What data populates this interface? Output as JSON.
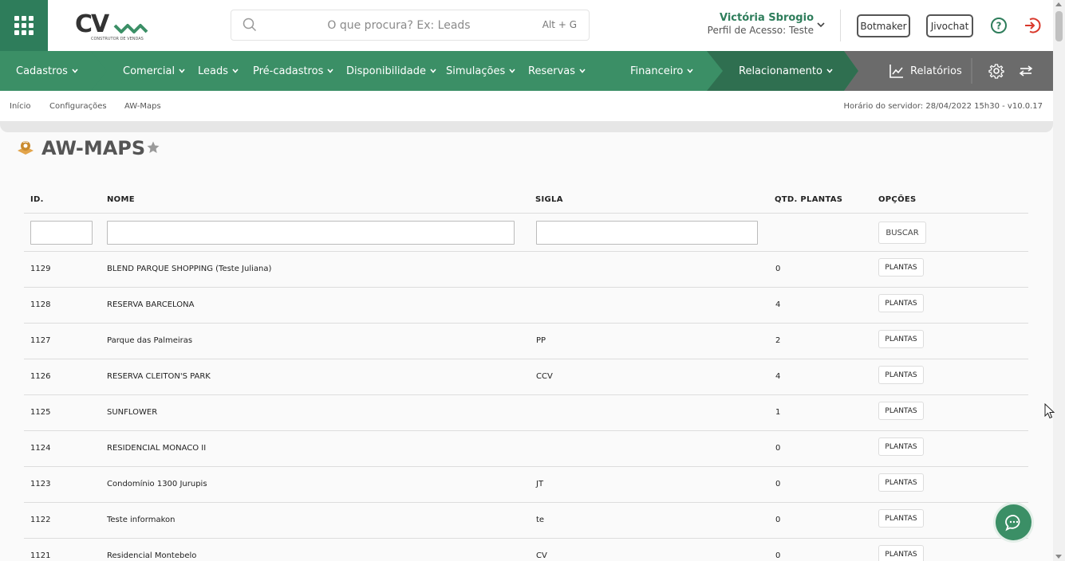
{
  "header": {
    "logo_text": "CV",
    "logo_subtitle": "CONSTRUTOR DE VENDAS",
    "search": {
      "placeholder": "O que procura? Ex: Leads",
      "shortcut": "Alt + G"
    },
    "user": {
      "name": "Victória Sbrogio",
      "profile": "Perfil de Acesso: Teste"
    },
    "buttons": {
      "botmaker": "Botmaker",
      "jivochat": "Jivochat"
    }
  },
  "nav": {
    "items": [
      {
        "label": "Cadastros"
      },
      {
        "label": "Comercial"
      },
      {
        "label": "Leads"
      },
      {
        "label": "Pré-cadastros"
      },
      {
        "label": "Disponibilidade"
      },
      {
        "label": "Simulações"
      },
      {
        "label": "Reservas"
      },
      {
        "label": "Financeiro"
      },
      {
        "label": "Relacionamento"
      },
      {
        "label": "Relatórios"
      }
    ]
  },
  "breadcrumb": {
    "items": [
      "Início",
      "Configurações",
      "AW-Maps"
    ],
    "server_time": "Horário do servidor: 28/04/2022 15h30 - v10.0.17"
  },
  "page": {
    "title": "AW-MAPS"
  },
  "table": {
    "columns": [
      "ID.",
      "NOME",
      "SIGLA",
      "QTD. PLANTAS",
      "OPÇÕES"
    ],
    "search_button": "BUSCAR",
    "row_button": "PLANTAS",
    "rows": [
      {
        "id": "1129",
        "nome": "BLEND PARQUE SHOPPING (Teste Juliana)",
        "sigla": "",
        "qtd": "0"
      },
      {
        "id": "1128",
        "nome": "RESERVA BARCELONA",
        "sigla": "",
        "qtd": "4"
      },
      {
        "id": "1127",
        "nome": "Parque das Palmeiras",
        "sigla": "PP",
        "qtd": "2"
      },
      {
        "id": "1126",
        "nome": "RESERVA CLEITON'S PARK",
        "sigla": "CCV",
        "qtd": "4"
      },
      {
        "id": "1125",
        "nome": "SUNFLOWER",
        "sigla": "",
        "qtd": "1"
      },
      {
        "id": "1124",
        "nome": "RESIDENCIAL MONACO II",
        "sigla": "",
        "qtd": "0"
      },
      {
        "id": "1123",
        "nome": "Condomínio 1300 Jurupis",
        "sigla": "JT",
        "qtd": "0"
      },
      {
        "id": "1122",
        "nome": "Teste informakon",
        "sigla": "te",
        "qtd": "0"
      },
      {
        "id": "1121",
        "nome": "Residencial Montebelo",
        "sigla": "CV",
        "qtd": "0"
      }
    ]
  },
  "colors": {
    "brand_green": "#3b8f66",
    "brand_dark_green": "#2e7d5b",
    "nav_dark_segment": "#2f6f50",
    "nav_gray_segment": "#6b6b6b",
    "logout_red": "#d9382b"
  }
}
